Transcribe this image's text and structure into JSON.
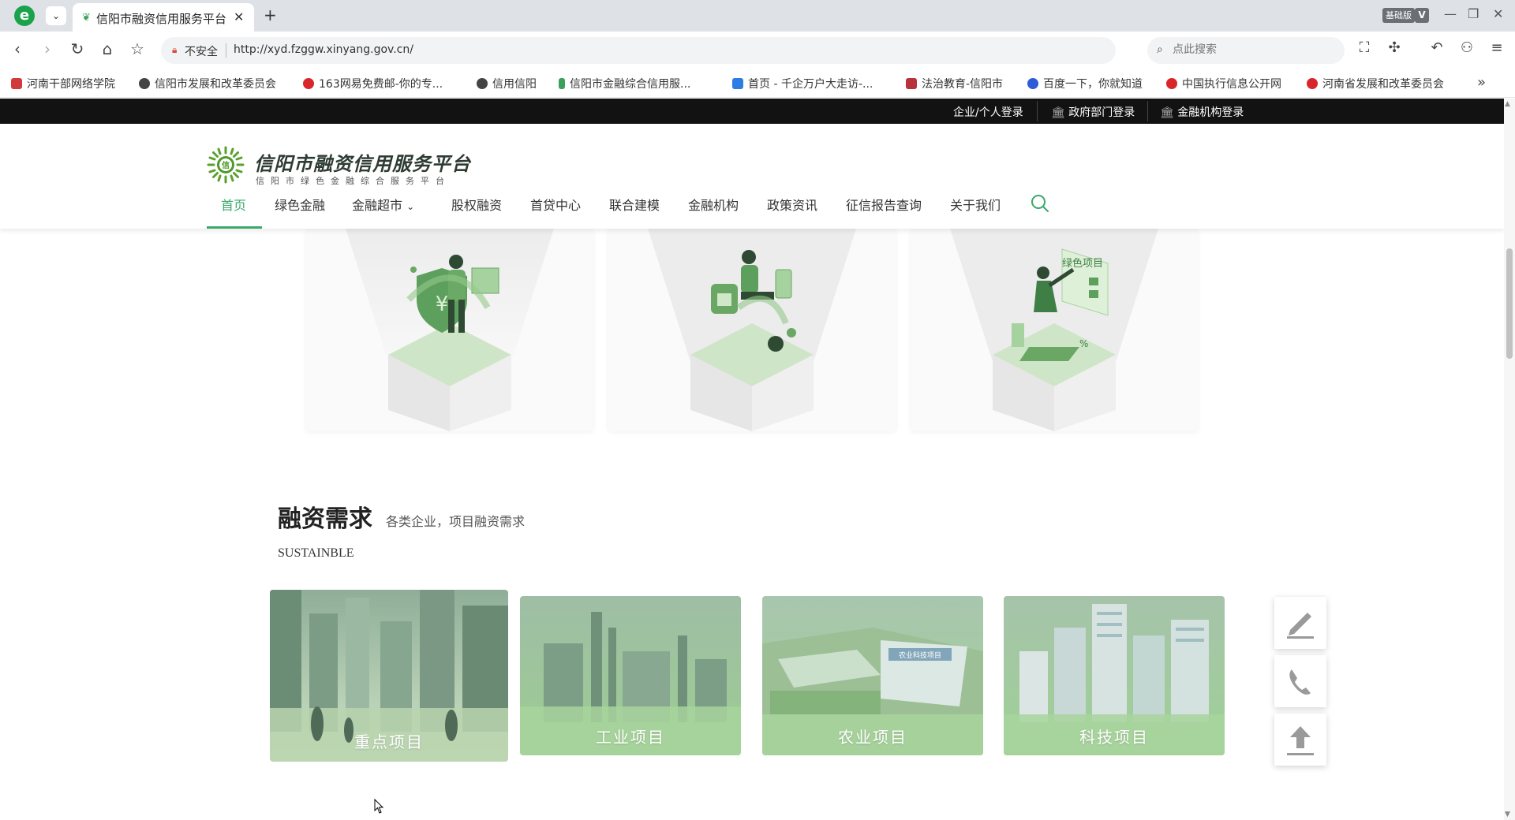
{
  "browser": {
    "tab_title": "信阳市融资信用服务平台",
    "insecure_label": "不安全",
    "url": "http://xyd.fzggw.xinyang.gov.cn/",
    "search_placeholder": "点此搜索",
    "edition_badge": "基础版",
    "edition_v": "V",
    "bookmarks": [
      {
        "label": "河南干部网络学院",
        "color": "#d23b3b"
      },
      {
        "label": "信阳市发展和改革委员会",
        "color": "#444444"
      },
      {
        "label": "163网易免费邮-你的专...",
        "color": "#d9262a"
      },
      {
        "label": "信用信阳",
        "color": "#444444"
      },
      {
        "label": "信阳市金融综合信用服...",
        "color": "#3aa15a"
      },
      {
        "label": "首页 - 千企万户大走访-...",
        "color": "#2d7be5"
      },
      {
        "label": "法治教育-信阳市",
        "color": "#b8323a"
      },
      {
        "label": "百度一下，你就知道",
        "color": "#2e5bd8"
      },
      {
        "label": "中国执行信息公开网",
        "color": "#d9262a"
      },
      {
        "label": "河南省发展和改革委员会",
        "color": "#d9262a"
      }
    ]
  },
  "site": {
    "login_links": [
      "企业/个人登录",
      "政府部门登录",
      "金融机构登录"
    ],
    "logo_title": "信阳市融资信用服务平台",
    "logo_subtitle": "信阳市绿色金融综合服务平台",
    "logo_mark_char": "信",
    "nav": [
      "首页",
      "绿色金融",
      "金融超市",
      "股权融资",
      "首贷中心",
      "联合建模",
      "金融机构",
      "政策资讯",
      "征信报告查询",
      "关于我们"
    ],
    "feature_card_3_tag": "绿色项目",
    "section": {
      "title": "融资需求",
      "subtitle": "各类企业，项目融资需求",
      "en": "SUSTAINBLE",
      "projects": [
        "重点项目",
        "工业项目",
        "农业项目",
        "科技项目"
      ],
      "agri_sign": "农业科技项目"
    },
    "accent_color": "#3aaa6a"
  }
}
